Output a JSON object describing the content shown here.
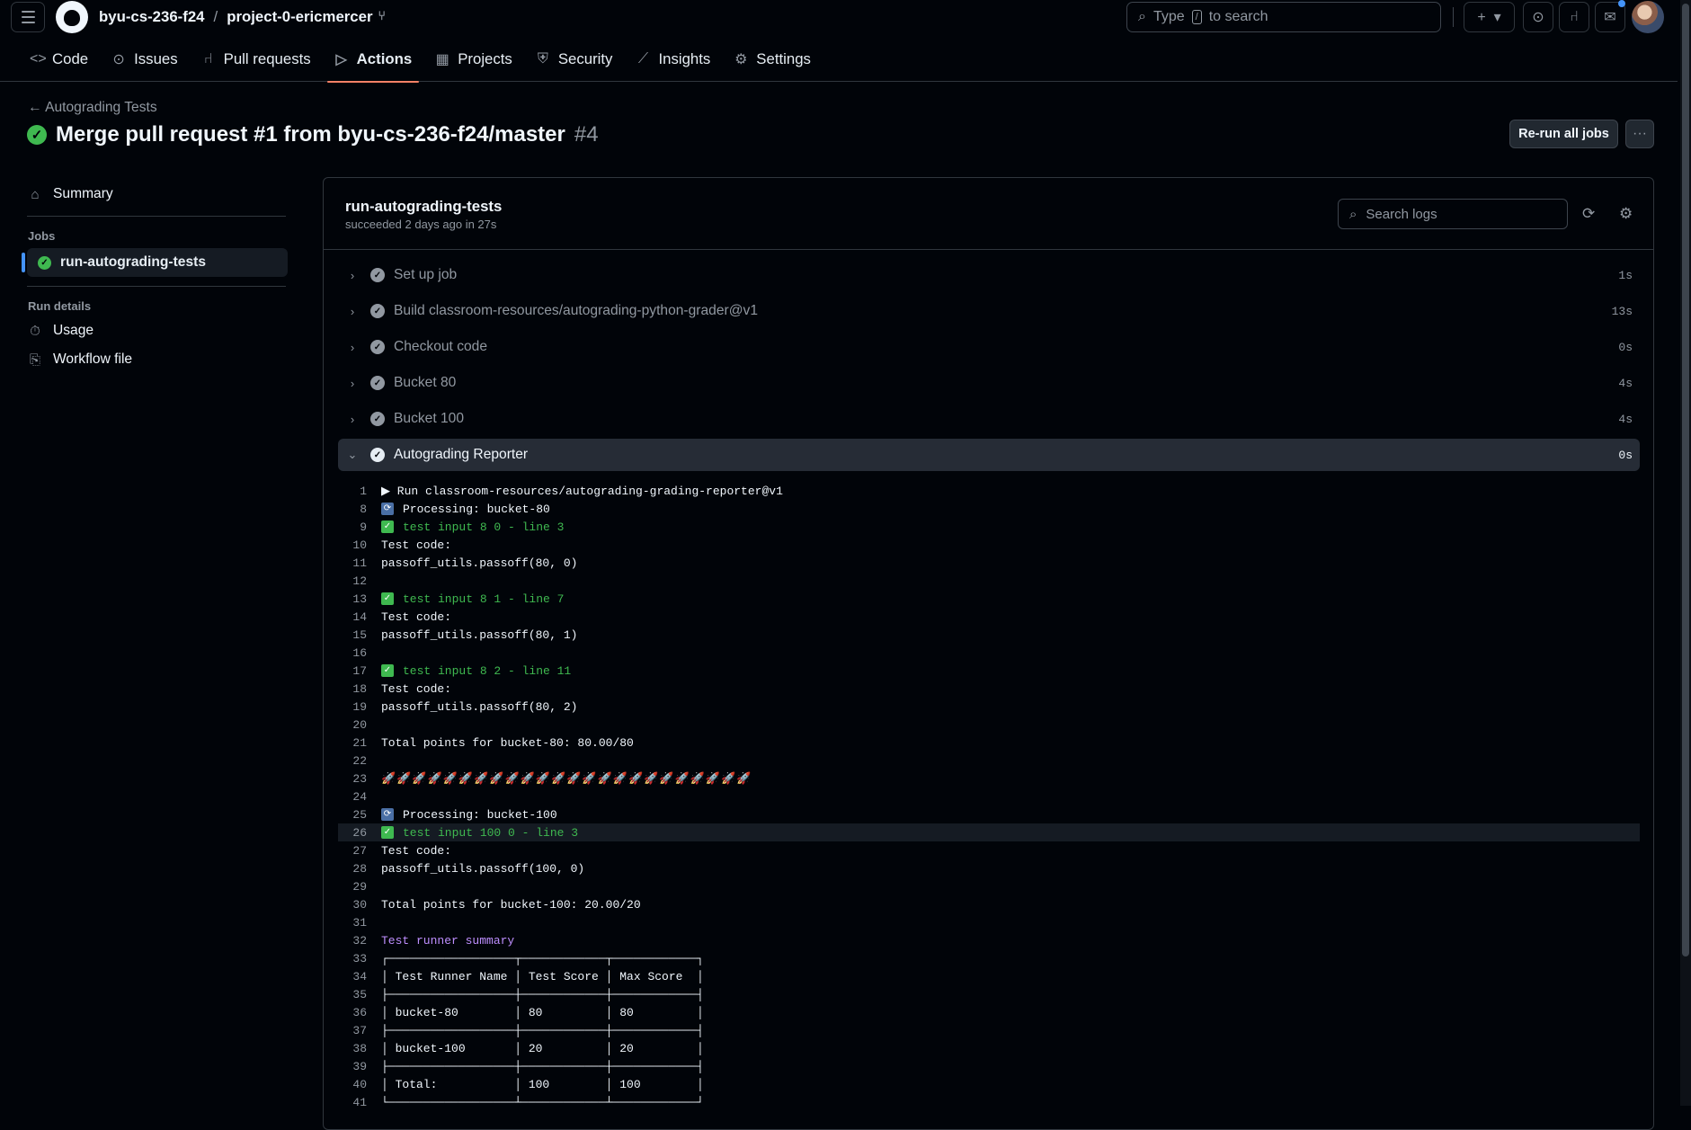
{
  "header": {
    "org": "byu-cs-236-f24",
    "separator": "/",
    "repo": "project-0-ericmercer",
    "search_placeholder_pre": "Type",
    "search_key": "/",
    "search_placeholder_post": "to search"
  },
  "tabs": [
    {
      "label": "Code",
      "icon": "code-icon"
    },
    {
      "label": "Issues",
      "icon": "issue-icon"
    },
    {
      "label": "Pull requests",
      "icon": "pull-request-icon"
    },
    {
      "label": "Actions",
      "icon": "play-icon"
    },
    {
      "label": "Projects",
      "icon": "table-icon"
    },
    {
      "label": "Security",
      "icon": "shield-icon"
    },
    {
      "label": "Insights",
      "icon": "graph-icon"
    },
    {
      "label": "Settings",
      "icon": "gear-icon"
    }
  ],
  "run": {
    "back_label": "Autograding Tests",
    "title": "Merge pull request #1 from byu-cs-236-f24/master",
    "number": "#4",
    "rerun_label": "Re-run all jobs",
    "more_label": "···"
  },
  "sidebar": {
    "summary": "Summary",
    "jobs_heading": "Jobs",
    "job": "run-autograding-tests",
    "details_heading": "Run details",
    "usage": "Usage",
    "workflow": "Workflow file"
  },
  "job": {
    "name": "run-autograding-tests",
    "status": "succeeded 2 days ago in 27s",
    "search_placeholder": "Search logs"
  },
  "steps": [
    {
      "label": "Set up job",
      "duration": "1s"
    },
    {
      "label": "Build classroom-resources/autograding-python-grader@v1",
      "duration": "13s"
    },
    {
      "label": "Checkout code",
      "duration": "0s"
    },
    {
      "label": "Bucket 80",
      "duration": "4s"
    },
    {
      "label": "Bucket 100",
      "duration": "4s"
    },
    {
      "label": "Autograding Reporter",
      "duration": "0s"
    }
  ],
  "log": {
    "l1": {
      "n": "1",
      "t": "▶ Run classroom-resources/autograding-grading-reporter@v1"
    },
    "l8": {
      "n": "8",
      "t": "Processing: bucket-80"
    },
    "l9": {
      "n": "9",
      "t": "test input 8 0 - line 3"
    },
    "l10": {
      "n": "10",
      "t": "Test code:"
    },
    "l11": {
      "n": "11",
      "t": "passoff_utils.passoff(80, 0)"
    },
    "l12": {
      "n": "12",
      "t": ""
    },
    "l13": {
      "n": "13",
      "t": "test input 8 1 - line 7"
    },
    "l14": {
      "n": "14",
      "t": "Test code:"
    },
    "l15": {
      "n": "15",
      "t": "passoff_utils.passoff(80, 1)"
    },
    "l16": {
      "n": "16",
      "t": ""
    },
    "l17": {
      "n": "17",
      "t": "test input 8 2 - line 11"
    },
    "l18": {
      "n": "18",
      "t": "Test code:"
    },
    "l19": {
      "n": "19",
      "t": "passoff_utils.passoff(80, 2)"
    },
    "l20": {
      "n": "20",
      "t": ""
    },
    "l21": {
      "n": "21",
      "t": "Total points for bucket-80: 80.00/80"
    },
    "l22": {
      "n": "22",
      "t": ""
    },
    "l23": {
      "n": "23",
      "t": "🚀🚀🚀🚀🚀🚀🚀🚀🚀🚀🚀🚀🚀🚀🚀🚀🚀🚀🚀🚀🚀🚀🚀🚀"
    },
    "l24": {
      "n": "24",
      "t": ""
    },
    "l25": {
      "n": "25",
      "t": "Processing: bucket-100"
    },
    "l26": {
      "n": "26",
      "t": "test input 100 0 - line 3"
    },
    "l27": {
      "n": "27",
      "t": "Test code:"
    },
    "l28": {
      "n": "28",
      "t": "passoff_utils.passoff(100, 0)"
    },
    "l29": {
      "n": "29",
      "t": ""
    },
    "l30": {
      "n": "30",
      "t": "Total points for bucket-100: 20.00/20"
    },
    "l31": {
      "n": "31",
      "t": ""
    },
    "l32": {
      "n": "32",
      "t": "Test runner summary"
    },
    "l33": {
      "n": "33",
      "t": "┌──────────────────┬────────────┬────────────┐"
    },
    "l34": {
      "n": "34",
      "t": "│ Test Runner Name │ Test Score │ Max Score  │"
    },
    "l35": {
      "n": "35",
      "t": "├──────────────────┼────────────┼────────────┤"
    },
    "l36": {
      "n": "36",
      "t": "│ bucket-80        │ 80         │ 80         │"
    },
    "l37": {
      "n": "37",
      "t": "├──────────────────┼────────────┼────────────┤"
    },
    "l38": {
      "n": "38",
      "t": "│ bucket-100       │ 20         │ 20         │"
    },
    "l39": {
      "n": "39",
      "t": "├──────────────────┼────────────┼────────────┤"
    },
    "l40": {
      "n": "40",
      "t": "│ Total:           │ 100        │ 100        │"
    },
    "l41": {
      "n": "41",
      "t": "└──────────────────┴────────────┴────────────┘"
    }
  }
}
